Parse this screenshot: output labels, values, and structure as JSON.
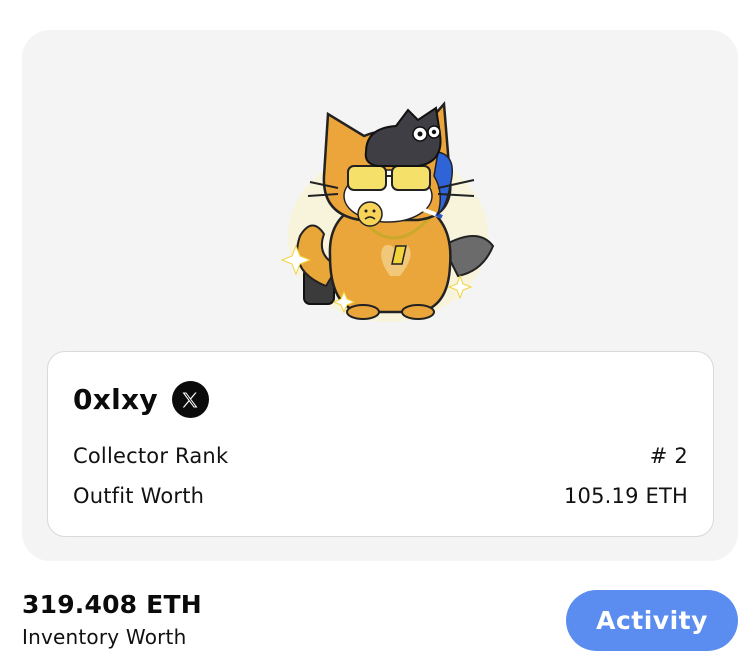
{
  "profile": {
    "username": "0xlxy",
    "social_icon": "x-logo-icon",
    "avatar_icon": "cat-avatar-icon",
    "stats": [
      {
        "label": "Collector Rank",
        "value": "# 2"
      },
      {
        "label": "Outfit Worth",
        "value": "105.19 ETH"
      }
    ]
  },
  "inventory": {
    "value": "319.408 ETH",
    "label": "Inventory Worth"
  },
  "actions": {
    "activity_label": "Activity"
  },
  "colors": {
    "card_bg": "#f4f4f4",
    "button_bg": "#5b8cf0",
    "text": "#0b0b0b"
  }
}
